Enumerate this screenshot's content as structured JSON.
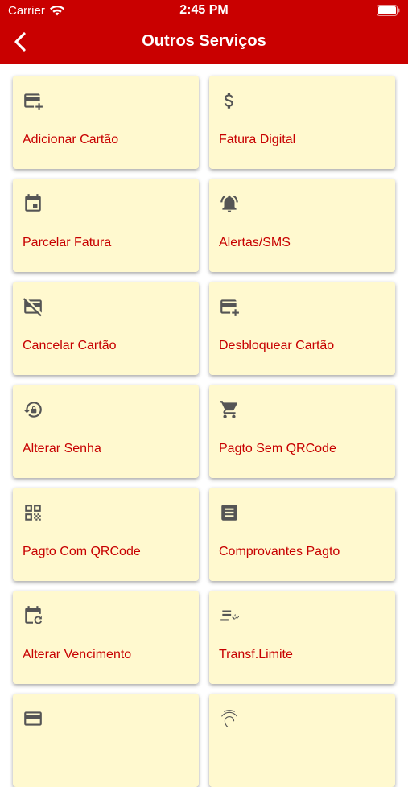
{
  "status_bar": {
    "carrier": "Carrier",
    "time": "2:45 PM"
  },
  "header": {
    "title": "Outros Serviços",
    "back_icon": "chevron-left-icon"
  },
  "colors": {
    "header_bg": "#c90000",
    "card_bg": "#fff9cf",
    "label": "#c70000",
    "icon": "#555555"
  },
  "services": [
    {
      "label": "Adicionar Cartão",
      "icon": "add-card-icon"
    },
    {
      "label": "Fatura Digital",
      "icon": "dollar-icon"
    },
    {
      "label": "Parcelar Fatura",
      "icon": "calendar-icon"
    },
    {
      "label": "Alertas/SMS",
      "icon": "bell-icon"
    },
    {
      "label": "Cancelar Cartão",
      "icon": "card-off-icon"
    },
    {
      "label": "Desbloquear Cartão",
      "icon": "add-card-icon"
    },
    {
      "label": "Alterar Senha",
      "icon": "lock-reset-icon"
    },
    {
      "label": "Pagto Sem QRCode",
      "icon": "cart-icon"
    },
    {
      "label": "Pagto Com QRCode",
      "icon": "qrcode-icon"
    },
    {
      "label": "Comprovantes Pagto",
      "icon": "receipt-icon"
    },
    {
      "label": "Alterar Vencimento",
      "icon": "calendar-refresh-icon"
    },
    {
      "label": "Transf.Limite",
      "icon": "transfer-icon"
    },
    {
      "label": "",
      "icon": "card-icon"
    },
    {
      "label": "",
      "icon": "fingerprint-icon"
    }
  ]
}
